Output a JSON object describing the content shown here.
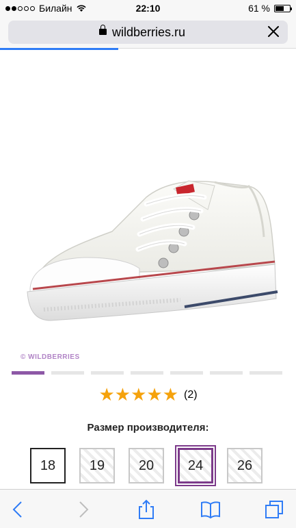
{
  "status_bar": {
    "carrier": "Билайн",
    "time": "22:10",
    "battery_percent": "61 %",
    "battery_level": 0.61,
    "signal_bars_filled": 2
  },
  "browser": {
    "url": "wildberries.ru",
    "page_load_progress": 0.4
  },
  "product": {
    "image_icon": "white-canvas-sneaker",
    "watermark": "© WILDBERRIES",
    "carousel_total": 7,
    "carousel_active": 1
  },
  "rating": {
    "stars": 5,
    "count": "(2)"
  },
  "sizes": {
    "title": "Размер производителя:",
    "options": [
      {
        "label": "18",
        "state": "available"
      },
      {
        "label": "19",
        "state": "unavailable"
      },
      {
        "label": "20",
        "state": "unavailable"
      },
      {
        "label": "24",
        "state": "selected"
      },
      {
        "label": "26",
        "state": "unavailable"
      }
    ]
  },
  "colors": {
    "accent": "#8d58a6",
    "star": "#f5a20c",
    "link": "#2f7cf6"
  }
}
